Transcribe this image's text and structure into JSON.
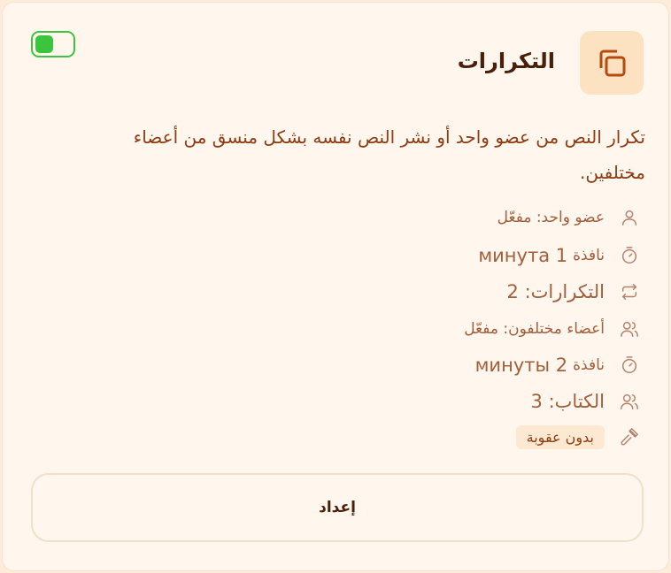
{
  "card": {
    "title": "التكرارات",
    "enabled": true,
    "description": "تكرار النص من عضو واحد أو نشر النص نفسه بشكل منسق من أعضاء مختلفين.",
    "rules": [
      {
        "icon": "user-icon",
        "text": "عضو واحد: مفعّل"
      },
      {
        "icon": "timer-icon",
        "label": "نافذة",
        "value": "1 минута"
      },
      {
        "icon": "repeat-icon",
        "text": "التكرارات: 2"
      },
      {
        "icon": "users-icon",
        "text": "أعضاء مختلفون: مفعّل"
      },
      {
        "icon": "timer-icon",
        "label": "نافذة",
        "value": "2 минуты"
      },
      {
        "icon": "users-icon",
        "text": "الكتاب: 3"
      },
      {
        "icon": "gavel-icon",
        "badge": "بدون عقوبة"
      }
    ],
    "setup_label": "إعداد",
    "colors": {
      "accent": "#b54a0f",
      "toggle_on": "#3cc53c",
      "card_bg": "#fff6ed",
      "page_bg": "#fdecd9"
    }
  }
}
